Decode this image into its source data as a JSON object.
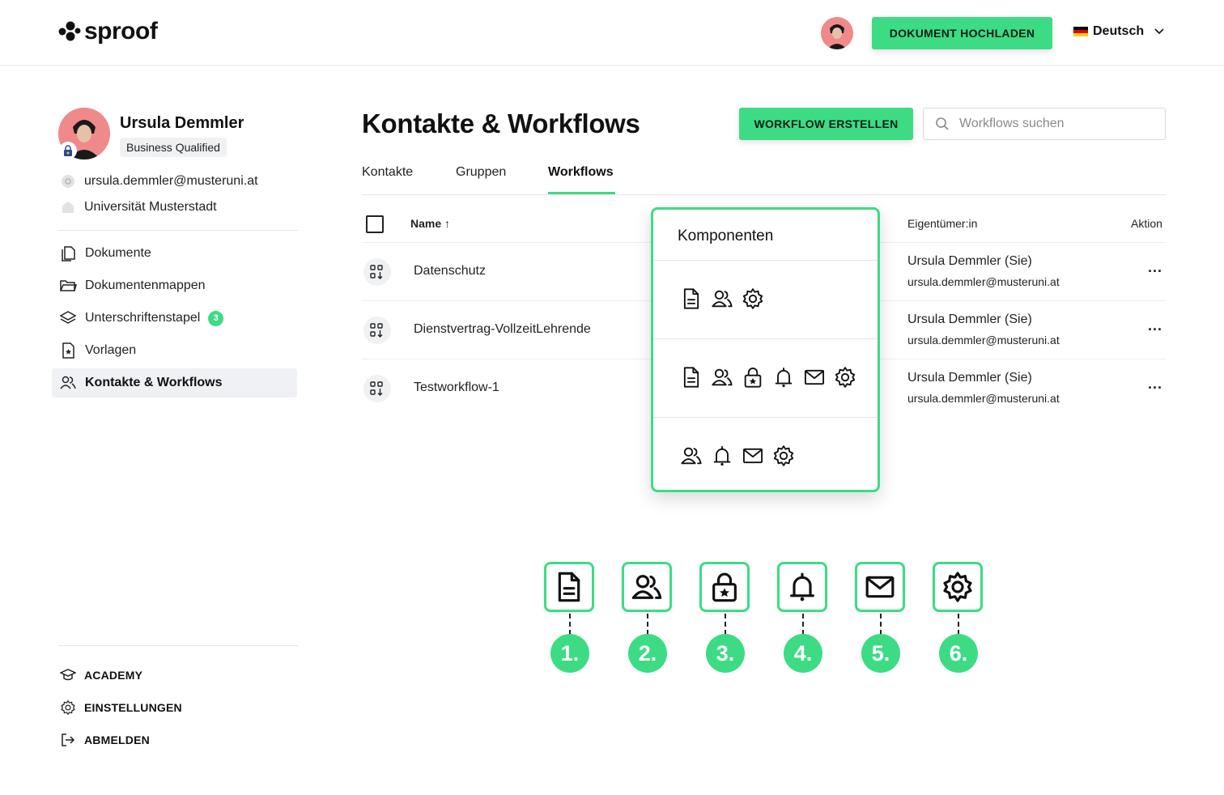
{
  "header": {
    "logo_text": "sproof",
    "upload_button": "DOKUMENT HOCHLADEN",
    "language": "Deutsch"
  },
  "profile": {
    "name": "Ursula Demmler",
    "badge": "Business Qualified",
    "email": "ursula.demmler@musteruni.at",
    "organization": "Universität Musterstadt"
  },
  "sidebar": {
    "items": [
      {
        "label": "Dokumente",
        "icon": "document-copy-icon"
      },
      {
        "label": "Dokumentenmappen",
        "icon": "folder-icon"
      },
      {
        "label": "Unterschriftenstapel",
        "icon": "layers-icon",
        "count": "3"
      },
      {
        "label": "Vorlagen",
        "icon": "template-star-icon"
      },
      {
        "label": "Kontakte & Workflows",
        "icon": "users-icon",
        "active": true
      }
    ],
    "bottom": [
      {
        "label": "ACADEMY",
        "icon": "graduation-cap-icon"
      },
      {
        "label": "EINSTELLUNGEN",
        "icon": "gear-icon"
      },
      {
        "label": "ABMELDEN",
        "icon": "logout-icon"
      }
    ]
  },
  "main": {
    "title": "Kontakte & Workflows",
    "create_button": "WORKFLOW ERSTELLEN",
    "search_placeholder": "Workflows suchen",
    "tabs": [
      "Kontakte",
      "Gruppen",
      "Workflows"
    ],
    "active_tab": "Workflows",
    "table": {
      "headers": {
        "name": "Name ↑",
        "owner": "Eigentümer:in",
        "action": "Aktion"
      },
      "rows": [
        {
          "name": "Datenschutz",
          "owner": "Ursula Demmler (Sie)",
          "owner_email": "ursula.demmler@musteruni.at",
          "action": "..."
        },
        {
          "name": "Dienstvertrag-VollzeitLehrende",
          "owner": "Ursula Demmler (Sie)",
          "owner_email": "ursula.demmler@musteruni.at",
          "action": "..."
        },
        {
          "name": "Testworkflow-1",
          "owner": "Ursula Demmler (Sie)",
          "owner_email": "ursula.demmler@musteruni.at",
          "action": "..."
        }
      ]
    }
  },
  "popover": {
    "title": "Komponenten",
    "rows": [
      [
        "document-icon",
        "users-icon",
        "gear-icon"
      ],
      [
        "document-icon",
        "users-icon",
        "lock-star-icon",
        "bell-icon",
        "mail-icon",
        "gear-icon"
      ],
      [
        "users-icon",
        "bell-icon",
        "mail-icon",
        "gear-icon"
      ]
    ]
  },
  "legend": [
    {
      "number": "1.",
      "icon": "document-icon"
    },
    {
      "number": "2.",
      "icon": "users-icon"
    },
    {
      "number": "3.",
      "icon": "lock-star-icon"
    },
    {
      "number": "4.",
      "icon": "bell-icon"
    },
    {
      "number": "5.",
      "icon": "mail-icon"
    },
    {
      "number": "6.",
      "icon": "gear-icon"
    }
  ],
  "colors": {
    "accent": "#3ddc84",
    "active_nav_bg": "#eff1f5",
    "avatar_bg": "#f08a8a"
  }
}
